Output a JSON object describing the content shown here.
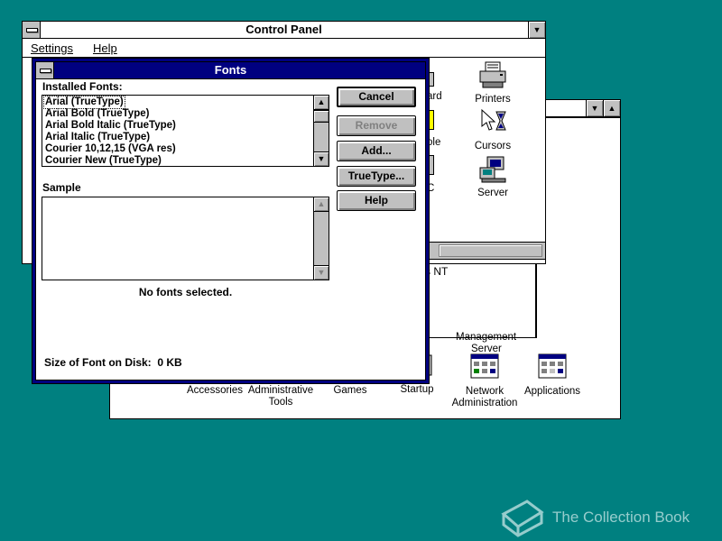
{
  "control_panel": {
    "title": "Control Panel",
    "menu": {
      "settings": "Settings",
      "help": "Help"
    },
    "icons": [
      {
        "label": "Printers",
        "icon": "printer-icon"
      },
      {
        "label": "Cursors",
        "icon": "cursor-icon"
      },
      {
        "label": "Server",
        "icon": "server-icon"
      }
    ],
    "partial_labels": {
      "keyboard_frag": "ard",
      "console_frag": "ole",
      "mac_frag": "C"
    }
  },
  "program_manager_group": {
    "partial_labels": {
      "nt_frag": "s NT",
      "mgmt_line1": "Management",
      "mgmt_line2": "Server"
    },
    "icons": [
      {
        "label": "Accessories"
      },
      {
        "label_line1": "Administrative",
        "label_line2": "Tools"
      },
      {
        "label": "Games"
      },
      {
        "label": "Startup"
      },
      {
        "label_line1": "Network",
        "label_line2": "Administration"
      },
      {
        "label": "Applications"
      }
    ]
  },
  "fonts_dialog": {
    "title": "Fonts",
    "installed_fonts_label": "Installed Fonts:",
    "fonts": [
      "Arial (TrueType)",
      "Arial Bold (TrueType)",
      "Arial Bold Italic (TrueType)",
      "Arial Italic (TrueType)",
      "Courier 10,12,15 (VGA res)",
      "Courier New (TrueType)"
    ],
    "selected_index": 0,
    "sample_label": "Sample",
    "sample_text": "No fonts selected.",
    "size_label": "Size of Font on Disk:",
    "size_value": "0 KB",
    "buttons": {
      "cancel": "Cancel",
      "remove": "Remove",
      "add": "Add...",
      "truetype": "TrueType...",
      "help": "Help"
    }
  },
  "watermark": {
    "text": "The Collection Book"
  },
  "colors": {
    "desktop": "#008080",
    "active_title": "#000080",
    "face": "#c0c0c0"
  }
}
